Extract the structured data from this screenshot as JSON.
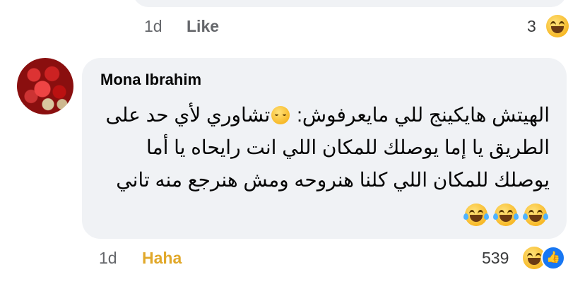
{
  "previous_comment": {
    "time": "1d",
    "like_label": "Like",
    "reaction_count": "3",
    "reaction_icon": "laughing-emoji-icon"
  },
  "comment": {
    "author": "Mona Ibrahim",
    "line1_text": "الهيتش هايكينج للي مايعرفوش: ",
    "line1_after_emoji": "تشاوري لأي حد على",
    "line2": "الطريق يا إما يوصلك للمكان اللي انت رايحاه يا أما",
    "line3": "يوصلك للمكان اللي كلنا هنروحه ومش هنرجع منه تاني",
    "inline_emoji": "relieved-face-emoji",
    "trailing_emojis": [
      "tears-of-joy-emoji",
      "tears-of-joy-emoji",
      "tears-of-joy-emoji"
    ],
    "time": "1d",
    "reaction_label": "Haha",
    "reaction_count": "539",
    "reaction_icons": [
      "laughing-emoji-icon",
      "like-thumb-icon"
    ]
  },
  "colors": {
    "bubble": "#f0f2f5",
    "haha": "#e1a82a",
    "meta_gray": "#65676b",
    "like_blue": "#1877f2"
  }
}
